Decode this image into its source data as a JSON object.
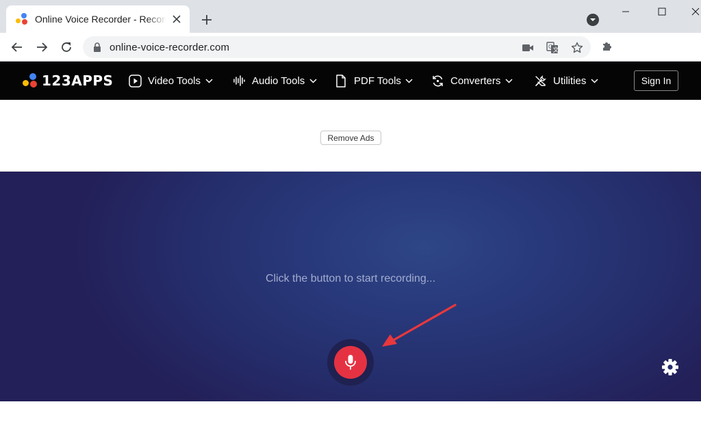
{
  "browser": {
    "tab_title": "Online Voice Recorder - Record Voice",
    "url": "online-voice-recorder.com",
    "icons": {
      "back": "arrow-left-icon",
      "forward": "arrow-right-icon",
      "reload": "reload-icon",
      "lock": "lock-icon",
      "camera": "camera-icon",
      "translate": "translate-icon",
      "bookmark": "star-icon",
      "extensions": "puzzle-icon"
    }
  },
  "site": {
    "logo_text": "123APPS",
    "nav": [
      {
        "label": "Video Tools",
        "icon": "play-icon"
      },
      {
        "label": "Audio Tools",
        "icon": "waveform-icon"
      },
      {
        "label": "PDF Tools",
        "icon": "document-icon"
      },
      {
        "label": "Converters",
        "icon": "convert-icon"
      },
      {
        "label": "Utilities",
        "icon": "tools-icon"
      }
    ],
    "sign_in": "Sign In"
  },
  "ad": {
    "remove_ads": "Remove Ads"
  },
  "recorder": {
    "hint": "Click the button to start recording...",
    "mic_icon": "microphone-icon",
    "settings_icon": "gear-icon"
  },
  "colors": {
    "record_red": "#e53242",
    "panel_dark": "#231f58",
    "panel_light": "#2e4686",
    "annotation_arrow": "#e8383d",
    "logo_blue": "#4285f4",
    "logo_red": "#ea4335",
    "logo_yellow": "#fbbc05"
  }
}
